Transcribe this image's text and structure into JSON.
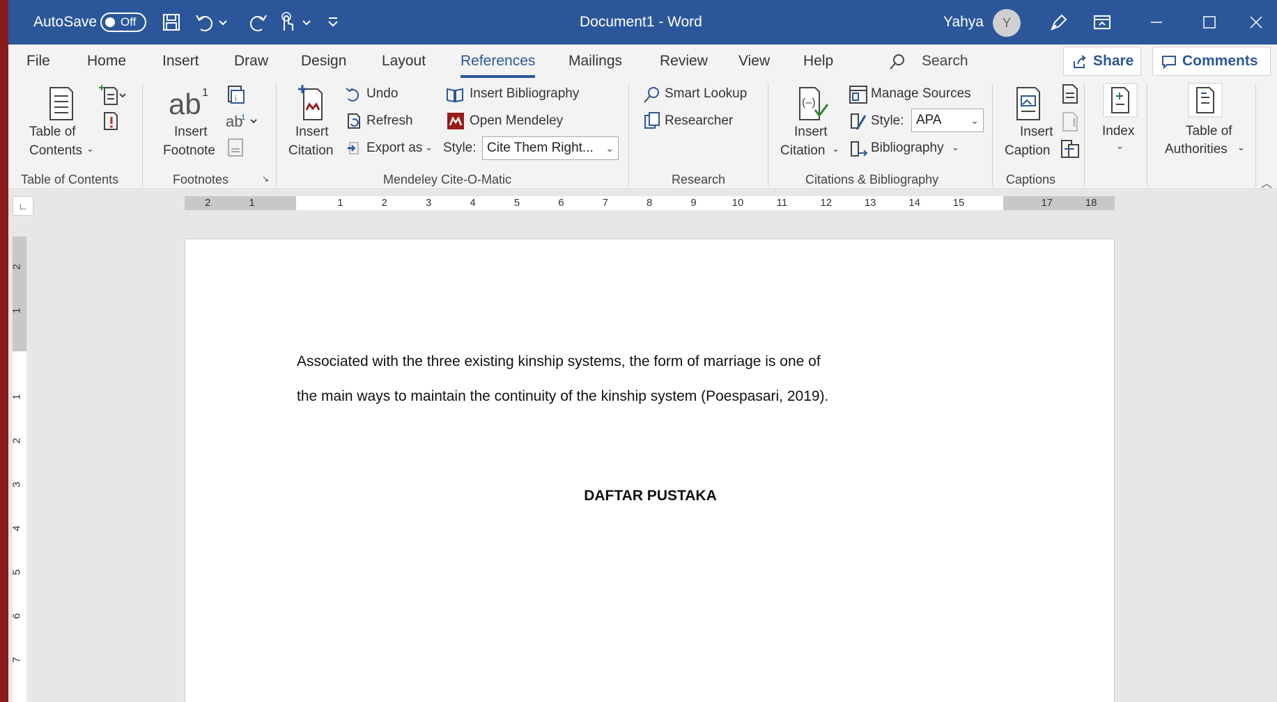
{
  "titlebar": {
    "autosave_label": "AutoSave",
    "autosave_state": "Off",
    "doc_title": "Document1  -  Word",
    "user_name": "Yahya",
    "user_initial": "Y"
  },
  "tabs": [
    "File",
    "Home",
    "Insert",
    "Draw",
    "Design",
    "Layout",
    "References",
    "Mailings",
    "Review",
    "View",
    "Help"
  ],
  "active_tab": "References",
  "search_label": "Search",
  "share_label": "Share",
  "comments_label": "Comments",
  "ribbon": {
    "toc": {
      "label_line1": "Table of",
      "label_line2": "Contents",
      "group": "Table of Contents"
    },
    "footnotes": {
      "insert_line1": "Insert",
      "insert_line2": "Footnote",
      "group": "Footnotes"
    },
    "mendeley": {
      "insert_line1": "Insert",
      "insert_line2": "Citation",
      "undo": "Undo",
      "refresh": "Refresh",
      "export": "Export as",
      "insert_bibliography": "Insert Bibliography",
      "open_mendeley": "Open Mendeley",
      "style_label": "Style:",
      "style_value": "Cite Them Right...",
      "group": "Mendeley Cite-O-Matic"
    },
    "research": {
      "smart_lookup": "Smart Lookup",
      "researcher": "Researcher",
      "group": "Research"
    },
    "citations": {
      "insert_line1": "Insert",
      "insert_line2": "Citation",
      "manage_sources": "Manage Sources",
      "style_label": "Style:",
      "style_value": "APA",
      "bibliography": "Bibliography",
      "group": "Citations & Bibliography"
    },
    "captions": {
      "insert_line1": "Insert",
      "insert_line2": "Caption",
      "group": "Captions"
    },
    "index": {
      "label": "Index"
    },
    "authorities": {
      "label_line1": "Table of",
      "label_line2": "Authorities"
    }
  },
  "ruler": {
    "h_labels": [
      "2",
      "1",
      "1",
      "2",
      "3",
      "4",
      "5",
      "6",
      "7",
      "8",
      "9",
      "10",
      "11",
      "12",
      "13",
      "14",
      "15",
      "17",
      "18"
    ],
    "v_labels": [
      "2",
      "1",
      "1",
      "2",
      "3",
      "4",
      "5",
      "6",
      "7"
    ]
  },
  "document": {
    "line1": "Associated with the three existing kinship systems, the form of marriage is one of",
    "line2": "the main ways to maintain the continuity of the kinship system (Poespasari, 2019).",
    "heading": "DAFTAR PUSTAKA"
  }
}
